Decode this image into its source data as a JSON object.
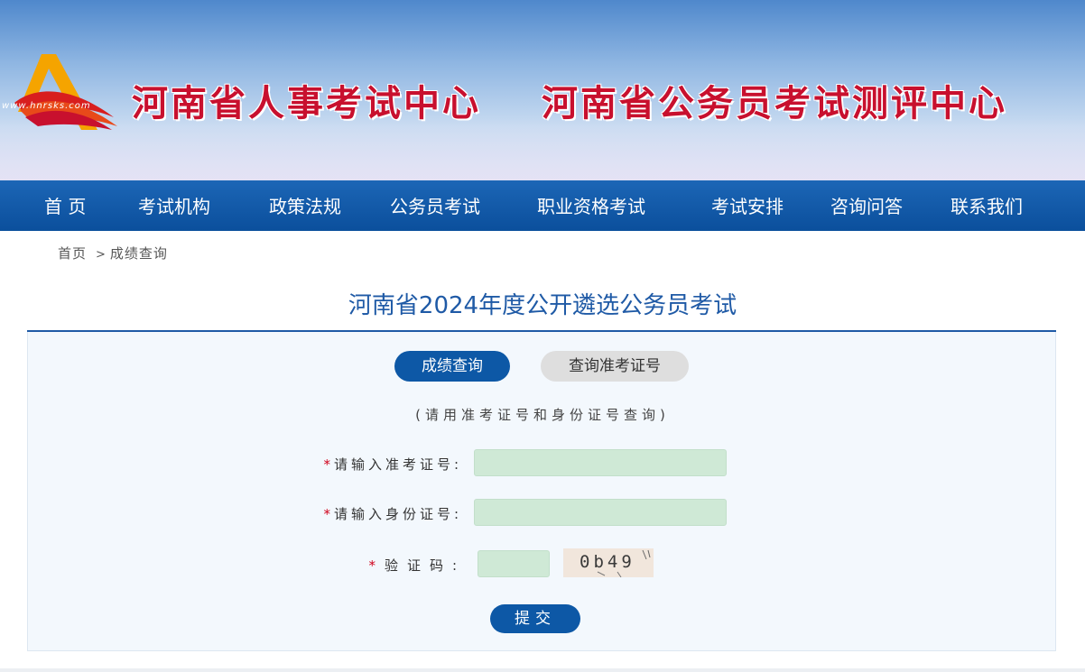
{
  "header": {
    "logo_url_text": "www.hnrsks.com",
    "title_1": "河南省人事考试中心",
    "title_2": "河南省公务员考试测评中心"
  },
  "nav": {
    "items": [
      {
        "label": "首 页"
      },
      {
        "label": "考试机构"
      },
      {
        "label": "政策法规"
      },
      {
        "label": "公务员考试"
      },
      {
        "label": "职业资格考试"
      },
      {
        "label": "考试安排"
      },
      {
        "label": "咨询问答"
      },
      {
        "label": "联系我们"
      }
    ]
  },
  "breadcrumb": {
    "home": "首页",
    "separator": ">",
    "current": "成绩查询"
  },
  "page": {
    "heading": "河南省2024年度公开遴选公务员考试"
  },
  "tabs": [
    {
      "label": "成绩查询",
      "active": true
    },
    {
      "label": "查询准考证号",
      "active": false
    }
  ],
  "form": {
    "hint": "(请用准考证号和身份证号查询)",
    "required_mark": "*",
    "exam_no_label": "请输入准考证号:",
    "exam_no_value": "",
    "id_no_label": "请输入身份证号:",
    "id_no_value": "",
    "captcha_label": "验证码:",
    "captcha_value": "",
    "captcha_image_text": "0b49",
    "submit_label": "提交"
  },
  "colors": {
    "nav_bg": "#0b4f9c",
    "accent_blue": "#0d58a6",
    "title_red": "#c8102e",
    "input_bg": "#cfe9d6",
    "required": "#d0021b"
  }
}
